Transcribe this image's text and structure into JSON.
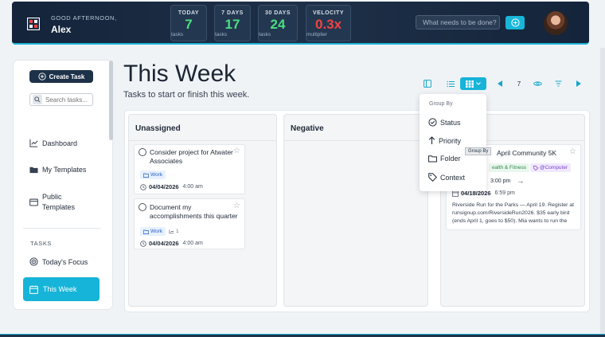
{
  "header": {
    "greeting": "GOOD AFTERNOON,",
    "user_name": "Alex",
    "stats": [
      {
        "label": "TODAY",
        "value": "7",
        "sub": "tasks",
        "color": "#4ade80"
      },
      {
        "label": "7 DAYS",
        "value": "17",
        "sub": "tasks",
        "color": "#4ade80"
      },
      {
        "label": "30 DAYS",
        "value": "24",
        "sub": "tasks",
        "color": "#4ade80"
      },
      {
        "label": "VELOCITY",
        "value": "0.3x",
        "sub": "multiplier",
        "color": "#ef4444"
      }
    ],
    "search_placeholder": "What needs to be done?"
  },
  "sidebar": {
    "create_label": "Create Task",
    "search_placeholder": "Search tasks...",
    "nav": [
      {
        "label": "Dashboard",
        "icon": "chart-line-icon"
      },
      {
        "label": "My Templates",
        "icon": "folder-icon"
      },
      {
        "label": "Public Templates",
        "icon": "inbox-icon"
      }
    ],
    "tasks_heading": "TASKS",
    "focus_label": "Today's Focus",
    "this_week_label": "This Week"
  },
  "main": {
    "title": "This Week",
    "subtitle": "Tasks to start or finish this week.",
    "toolbar_count": "7"
  },
  "columns": [
    {
      "title": "Unassigned",
      "cards": [
        {
          "title": "Consider project for Atwater Associates",
          "tag": "Work",
          "sub": "",
          "date": "04/04/2026",
          "time": "4:00 am"
        },
        {
          "title": "Document my accomplishments this quarter",
          "tag": "Work",
          "sub": "1",
          "date": "04/04/2026",
          "time": "4:00 am"
        }
      ]
    },
    {
      "title": "Negative",
      "cards": []
    },
    {
      "title": "",
      "card": {
        "title": "April Community 5K",
        "tag1": "ealth & Fitness",
        "tag2": "@Computer",
        "time1": "3:00 pm",
        "date2": "04/18/2026",
        "time2": "6:59 pm",
        "desc_line1": "Riverside Run for the Parks — April 19. Register at",
        "desc_line2": "runsignup.com/RiversideRun2026. $35 early bird",
        "desc_line3": "(ends April 1, goes to $50). Mia wants to run the"
      }
    }
  ],
  "group_by": {
    "heading": "Group By",
    "items": [
      "Status",
      "Priority",
      "Folder",
      "Context"
    ],
    "tooltip": "Group By"
  }
}
